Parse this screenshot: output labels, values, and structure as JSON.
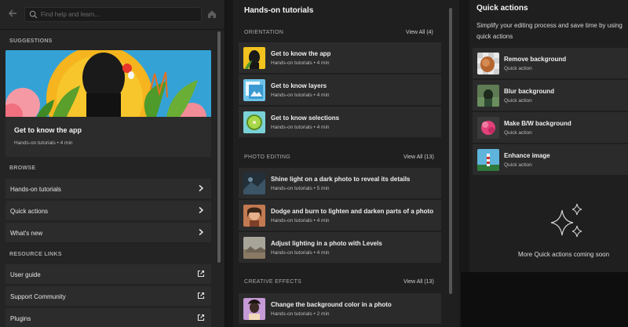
{
  "search": {
    "placeholder": "Find help and learn..."
  },
  "panel1": {
    "suggestions_label": "SUGGESTIONS",
    "hero": {
      "title": "Get to know the app",
      "subtitle": "Hands-on tutorials • 4 min"
    },
    "browse_label": "BROWSE",
    "browse_items": [
      {
        "label": "Hands-on tutorials"
      },
      {
        "label": "Quick actions"
      },
      {
        "label": "What's new"
      }
    ],
    "resource_label": "RESOURCE LINKS",
    "resource_items": [
      {
        "label": "User guide"
      },
      {
        "label": "Support Community"
      },
      {
        "label": "Plugins"
      }
    ]
  },
  "panel2": {
    "title": "Hands-on tutorials",
    "orientation": {
      "label": "ORIENTATION",
      "view_all": "View All (4)",
      "items": [
        {
          "title": "Get to know the app",
          "subtitle": "Hands-on tutorials • 4 min"
        },
        {
          "title": "Get to know layers",
          "subtitle": "Hands-on tutorials • 4 min"
        },
        {
          "title": "Get to know selections",
          "subtitle": "Hands-on tutorials • 4 min"
        }
      ]
    },
    "photo_editing": {
      "label": "PHOTO EDITING",
      "view_all": "View All (13)",
      "items": [
        {
          "title": "Shine light on a dark photo to reveal its details",
          "subtitle": "Hands-on tutorials • 5 min"
        },
        {
          "title": "Dodge and burn to lighten and darken parts of a photo",
          "subtitle": "Hands-on tutorials • 4 min"
        },
        {
          "title": "Adjust lighting in a photo with Levels",
          "subtitle": "Hands-on tutorials • 4 min"
        }
      ]
    },
    "creative_effects": {
      "label": "CREATIVE EFFECTS",
      "view_all": "View All (13)",
      "items": [
        {
          "title": "Change the background color in a photo",
          "subtitle": "Hands-on tutorials • 2 min"
        }
      ]
    }
  },
  "panel3": {
    "title": "Quick actions",
    "description": "Simplify your editing process and save time by using quick actions",
    "items": [
      {
        "title": "Remove background",
        "subtitle": "Quick action"
      },
      {
        "title": "Blur background",
        "subtitle": "Quick action"
      },
      {
        "title": "Make B/W background",
        "subtitle": "Quick action"
      },
      {
        "title": "Enhance image",
        "subtitle": "Quick action"
      }
    ],
    "coming_soon": "More Quick actions coming soon"
  }
}
